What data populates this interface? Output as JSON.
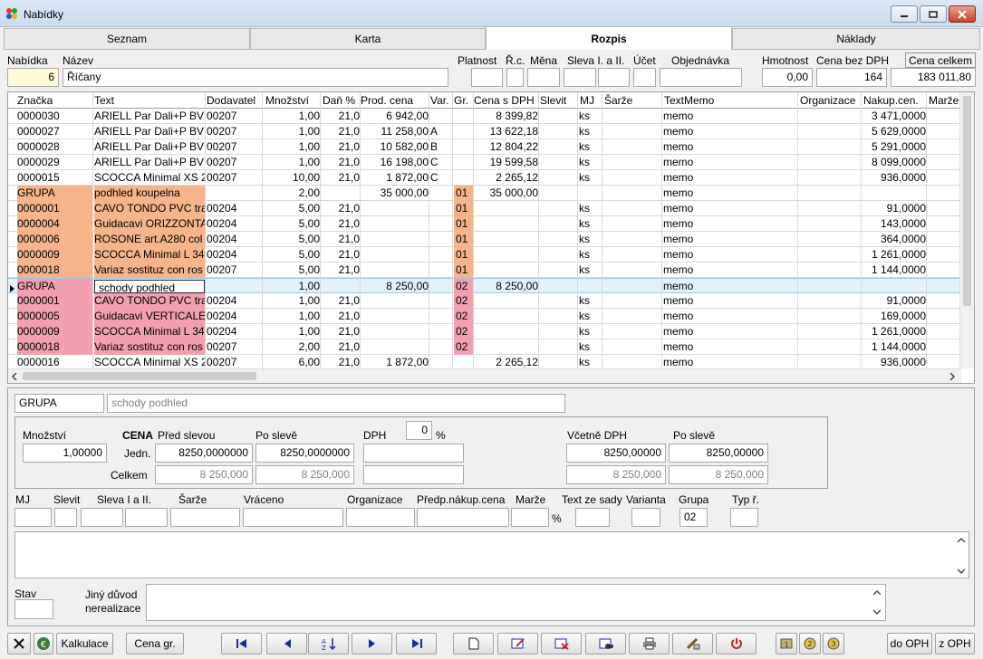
{
  "window": {
    "title": "Nabídky"
  },
  "tabs": [
    "Seznam",
    "Karta",
    "Rozpis",
    "Náklady"
  ],
  "header_labels": {
    "nabidka": "Nabídka",
    "nazev": "Název",
    "platnost": "Platnost",
    "rc": "Ř.c.",
    "mena": "Měna",
    "sleva": "Sleva I. a II.",
    "ucet": "Účet",
    "objednavka": "Objednávka",
    "hmotnost": "Hmotnost",
    "cena_bez": "Cena bez DPH",
    "cena_celkem": "Cena celkem"
  },
  "header_values": {
    "nabidka": "6",
    "nazev": "Říčany",
    "hmotnost": "0,00",
    "cena_bez": "164",
    "cena_celkem": "183 011,80"
  },
  "grid": {
    "columns": [
      "Značka",
      "Text",
      "Dodavatel",
      "Množství",
      "Daň %",
      "Prod. cena",
      "Var.",
      "Gr.",
      "Cena s DPH",
      "Slevit",
      "MJ",
      "Šarže",
      "TextMemo",
      "Organizace",
      "Nakup.cen.",
      "Marže"
    ],
    "rows": [
      {
        "znacka": "0000030",
        "text": "ARIELL Par Dali+P BV",
        "dodavatel": "00207",
        "mnozstvi": "1,00",
        "dan": "21,0",
        "prod": "6 942,00",
        "var": "",
        "gr": "",
        "cena": "8 399,82",
        "mj": "ks",
        "memo": "memo",
        "nakup": "3 471,0000",
        "color": ""
      },
      {
        "znacka": "0000027",
        "text": "ARIELL Par Dali+P BV",
        "dodavatel": "00207",
        "mnozstvi": "1,00",
        "dan": "21,0",
        "prod": "11 258,00",
        "var": "A",
        "gr": "",
        "cena": "13 622,18",
        "mj": "ks",
        "memo": "memo",
        "nakup": "5 629,0000",
        "color": ""
      },
      {
        "znacka": "0000028",
        "text": "ARIELL Par Dali+P BV",
        "dodavatel": "00207",
        "mnozstvi": "1,00",
        "dan": "21,0",
        "prod": "10 582,00",
        "var": "B",
        "gr": "",
        "cena": "12 804,22",
        "mj": "ks",
        "memo": "memo",
        "nakup": "5 291,0000",
        "color": ""
      },
      {
        "znacka": "0000029",
        "text": "ARIELL Par Dali+P BV",
        "dodavatel": "00207",
        "mnozstvi": "1,00",
        "dan": "21,0",
        "prod": "16 198,00",
        "var": "C",
        "gr": "",
        "cena": "19 599,58",
        "mj": "ks",
        "memo": "memo",
        "nakup": "8 099,0000",
        "color": ""
      },
      {
        "znacka": "0000015",
        "text": "SCOCCA Minimal XS 2",
        "dodavatel": "00207",
        "mnozstvi": "10,00",
        "dan": "21,0",
        "prod": "1 872,00",
        "var": "C",
        "gr": "",
        "cena": "2 265,12",
        "mj": "ks",
        "memo": "memo",
        "nakup": "936,0000",
        "color": ""
      },
      {
        "znacka": "GRUPA",
        "text": "podhled koupelna",
        "dodavatel": "",
        "mnozstvi": "2,00",
        "dan": "",
        "prod": "35 000,00",
        "var": "",
        "gr": "01",
        "cena": "35 000,00",
        "mj": "",
        "memo": "memo",
        "nakup": "",
        "color": "#f5b48a"
      },
      {
        "znacka": "0000001",
        "text": "CAVO TONDO PVC tra",
        "dodavatel": "00204",
        "mnozstvi": "5,00",
        "dan": "21,0",
        "prod": "",
        "var": "",
        "gr": "01",
        "cena": "",
        "mj": "ks",
        "memo": "memo",
        "nakup": "91,0000",
        "color": "#f5b48a"
      },
      {
        "znacka": "0000004",
        "text": "Guidacavi ORIZZONTA",
        "dodavatel": "00204",
        "mnozstvi": "5,00",
        "dan": "21,0",
        "prod": "",
        "var": "",
        "gr": "01",
        "cena": "",
        "mj": "ks",
        "memo": "memo",
        "nakup": "143,0000",
        "color": "#f5b48a"
      },
      {
        "znacka": "0000006",
        "text": "ROSONE art.A280 col",
        "dodavatel": "00204",
        "mnozstvi": "5,00",
        "dan": "21,0",
        "prod": "",
        "var": "",
        "gr": "01",
        "cena": "",
        "mj": "ks",
        "memo": "memo",
        "nakup": "364,0000",
        "color": "#f5b48a"
      },
      {
        "znacka": "0000009",
        "text": "SCOCCA Minimal L 34",
        "dodavatel": "00204",
        "mnozstvi": "5,00",
        "dan": "21,0",
        "prod": "",
        "var": "",
        "gr": "01",
        "cena": "",
        "mj": "ks",
        "memo": "memo",
        "nakup": "1 261,0000",
        "color": "#f5b48a"
      },
      {
        "znacka": "0000018",
        "text": "Variaz sostituz con ros",
        "dodavatel": "00207",
        "mnozstvi": "5,00",
        "dan": "21,0",
        "prod": "",
        "var": "",
        "gr": "01",
        "cena": "",
        "mj": "ks",
        "memo": "memo",
        "nakup": "1 144,0000",
        "color": "#f5b48a"
      },
      {
        "znacka": "GRUPA",
        "text": "schody podhled",
        "dodavatel": "",
        "mnozstvi": "1,00",
        "dan": "",
        "prod": "8 250,00",
        "var": "",
        "gr": "02",
        "cena": "8 250,00",
        "mj": "",
        "memo": "memo",
        "nakup": "",
        "color": "#f2a0b0",
        "selected": true
      },
      {
        "znacka": "0000001",
        "text": "CAVO TONDO PVC tra",
        "dodavatel": "00204",
        "mnozstvi": "1,00",
        "dan": "21,0",
        "prod": "",
        "var": "",
        "gr": "02",
        "cena": "",
        "mj": "ks",
        "memo": "memo",
        "nakup": "91,0000",
        "color": "#f2a0b0"
      },
      {
        "znacka": "0000005",
        "text": "Guidacavi VERTICALE",
        "dodavatel": "00204",
        "mnozstvi": "1,00",
        "dan": "21,0",
        "prod": "",
        "var": "",
        "gr": "02",
        "cena": "",
        "mj": "ks",
        "memo": "memo",
        "nakup": "169,0000",
        "color": "#f2a0b0"
      },
      {
        "znacka": "0000009",
        "text": "SCOCCA Minimal L 34",
        "dodavatel": "00204",
        "mnozstvi": "1,00",
        "dan": "21,0",
        "prod": "",
        "var": "",
        "gr": "02",
        "cena": "",
        "mj": "ks",
        "memo": "memo",
        "nakup": "1 261,0000",
        "color": "#f2a0b0"
      },
      {
        "znacka": "0000018",
        "text": "Variaz sostituz con ros",
        "dodavatel": "00207",
        "mnozstvi": "2,00",
        "dan": "21,0",
        "prod": "",
        "var": "",
        "gr": "02",
        "cena": "",
        "mj": "ks",
        "memo": "memo",
        "nakup": "1 144,0000",
        "color": "#f2a0b0"
      },
      {
        "znacka": "0000016",
        "text": "SCOCCA Minimal XS 2",
        "dodavatel": "00207",
        "mnozstvi": "6,00",
        "dan": "21,0",
        "prod": "1 872,00",
        "var": "",
        "gr": "",
        "cena": "2 265,12",
        "mj": "ks",
        "memo": "memo",
        "nakup": "936,0000",
        "color": ""
      }
    ]
  },
  "detail": {
    "znacka": "GRUPA",
    "text": "schody podhled",
    "mnozstvi_label": "Množství",
    "mnozstvi": "1,00000",
    "cena_label": "CENA",
    "pred_slevou": "Před slevou",
    "po_sleve": "Po slevě",
    "dph_label": "DPH",
    "dph": "0",
    "pct": "%",
    "jedn": "Jedn.",
    "celkem": "Celkem",
    "jedn_pred": "8250,0000000",
    "jedn_po": "8250,0000000",
    "celkem_pred": "8 250,000",
    "celkem_po": "8 250,000",
    "vcetne_dph": "Včetně DPH",
    "po_sleve2": "Po slevě",
    "v_jedn": "8250,00000",
    "v_jedn_po": "8250,00000",
    "v_celkem": "8 250,000",
    "v_celkem_po": "8 250,000",
    "labels2": {
      "mj": "MJ",
      "slevit": "Slevit",
      "sleva": "Sleva I a II.",
      "sarze": "Šarže",
      "vraceno": "Vráceno",
      "organizace": "Organizace",
      "predp": "Předp.nákup.cena",
      "marze": "Marže",
      "text_ze_sady": "Text ze sady",
      "varianta": "Varianta",
      "grupa": "Grupa",
      "typ": "Typ ř."
    },
    "grupa": "02",
    "stav": "Stav",
    "jiny_duvod": "Jiný důvod",
    "nerealizace": "nerealizace"
  },
  "toolbar": {
    "kalkulace": "Kalkulace",
    "cena_gr": "Cena gr.",
    "do_oph": "do OPH",
    "z_oph": "z OPH"
  }
}
